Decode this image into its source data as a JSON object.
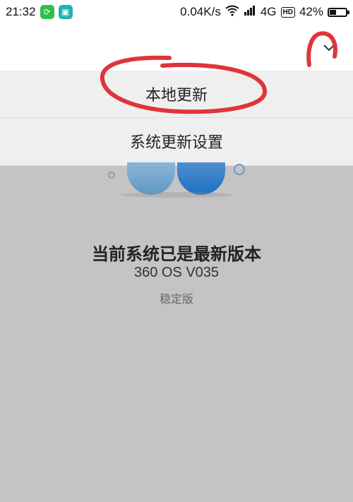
{
  "status_bar": {
    "time": "21:32",
    "app_icons": [
      "refresh-app-icon",
      "scan-app-icon"
    ],
    "network_speed": "0.04K/s",
    "network_type": "4G",
    "hd_label": "HD",
    "battery_percent": "42%",
    "battery_level": 0.42
  },
  "menu": {
    "items": [
      {
        "label": "本地更新"
      },
      {
        "label": "系统更新设置"
      }
    ]
  },
  "update_status": {
    "title": "当前系统已是最新版本",
    "version": "360 OS V035",
    "channel": "稳定版"
  },
  "colors": {
    "annotation": "#e0343b",
    "dim_background": "#c4c4c4",
    "menu_background": "#efefef"
  }
}
